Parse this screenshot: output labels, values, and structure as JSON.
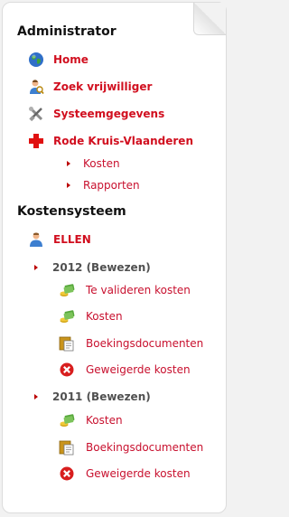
{
  "admin": {
    "title": "Administrator",
    "items": [
      {
        "label": "Home",
        "icon": "globe-icon"
      },
      {
        "label": "Zoek vrijwilliger",
        "icon": "user-search-icon"
      },
      {
        "label": "Systeemgegevens",
        "icon": "tools-icon"
      },
      {
        "label": "Rode Kruis-Vlaanderen",
        "icon": "red-cross-icon"
      }
    ],
    "subitems": [
      {
        "label": "Kosten"
      },
      {
        "label": "Rapporten"
      }
    ]
  },
  "costs": {
    "title": "Kostensysteem",
    "user": {
      "label": "ELLEN",
      "icon": "user-icon"
    },
    "years": [
      {
        "label": "2012 (Bewezen)",
        "items": [
          {
            "label": "Te valideren kosten",
            "icon": "money-icon"
          },
          {
            "label": "Kosten",
            "icon": "money-icon"
          },
          {
            "label": "Boekingsdocumenten",
            "icon": "documents-icon"
          },
          {
            "label": "Geweigerde kosten",
            "icon": "rejected-icon"
          }
        ]
      },
      {
        "label": "2011 (Bewezen)",
        "items": [
          {
            "label": "Kosten",
            "icon": "money-icon"
          },
          {
            "label": "Boekingsdocumenten",
            "icon": "documents-icon"
          },
          {
            "label": "Geweigerde kosten",
            "icon": "rejected-icon"
          }
        ]
      }
    ]
  },
  "colors": {
    "accent": "#d10f1f",
    "muted": "#505050"
  }
}
